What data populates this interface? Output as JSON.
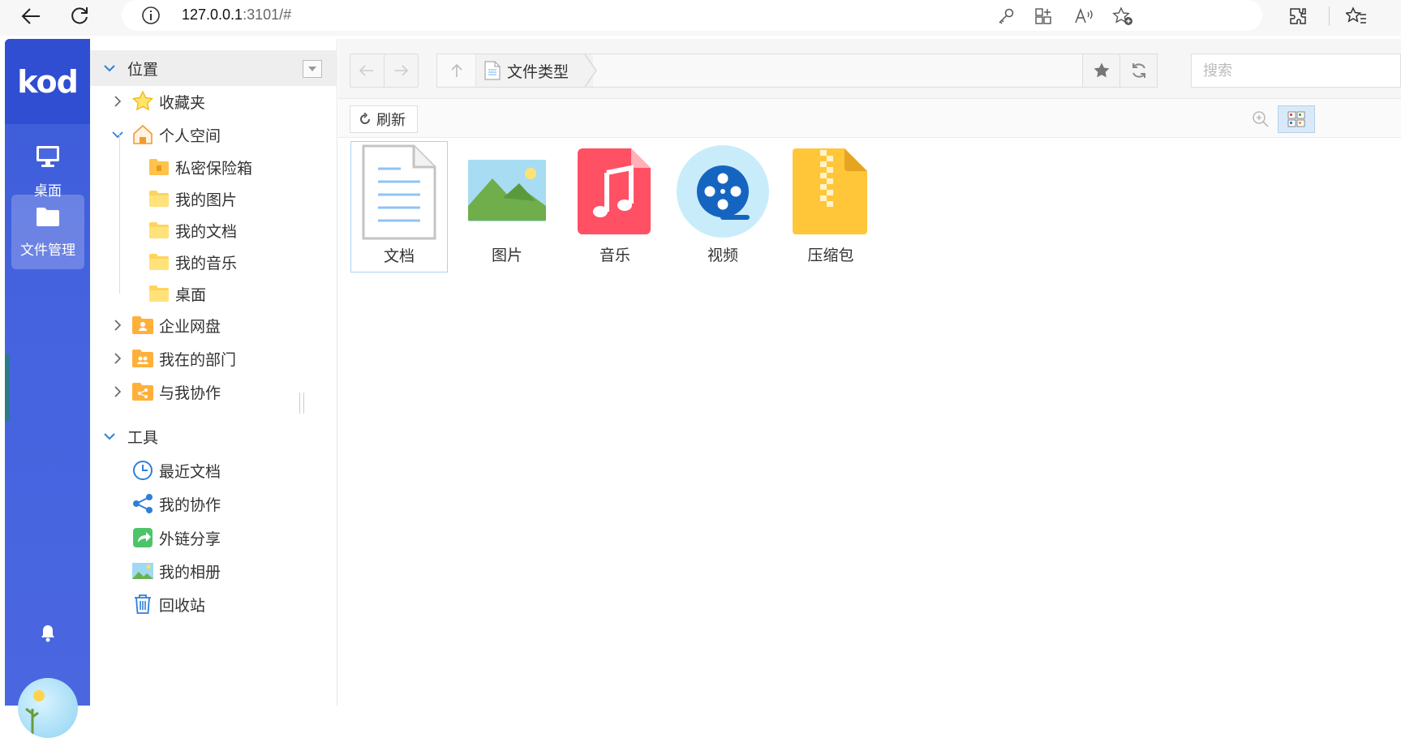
{
  "browser": {
    "url_host": "127.0.0.1",
    "url_rest": ":3101/#"
  },
  "rail": {
    "logo": "kod",
    "items": [
      {
        "label": "桌面",
        "icon": "monitor-icon"
      },
      {
        "label": "文件管理",
        "icon": "folder-icon"
      }
    ]
  },
  "tree": {
    "location_header": "位置",
    "items": [
      {
        "label": "收藏夹",
        "icon": "star-icon"
      },
      {
        "label": "个人空间",
        "icon": "home-icon"
      },
      {
        "label": "私密保险箱",
        "icon": "safe-folder-icon"
      },
      {
        "label": "我的图片",
        "icon": "folder-icon"
      },
      {
        "label": "我的文档",
        "icon": "folder-icon"
      },
      {
        "label": "我的音乐",
        "icon": "folder-icon"
      },
      {
        "label": "桌面",
        "icon": "folder-icon"
      },
      {
        "label": "企业网盘",
        "icon": "enterprise-folder-icon"
      },
      {
        "label": "我在的部门",
        "icon": "department-folder-icon"
      },
      {
        "label": "与我协作",
        "icon": "share-folder-icon"
      }
    ],
    "tools_header": "工具",
    "tools": [
      {
        "label": "最近文档",
        "icon": "clock-icon"
      },
      {
        "label": "我的协作",
        "icon": "share-nodes-icon"
      },
      {
        "label": "外链分享",
        "icon": "external-share-icon"
      },
      {
        "label": "我的相册",
        "icon": "album-icon"
      },
      {
        "label": "回收站",
        "icon": "trash-icon"
      }
    ]
  },
  "toolbar": {
    "breadcrumb": "文件类型",
    "search_placeholder": "搜索",
    "refresh_label": "刷新"
  },
  "files": [
    {
      "name": "文档",
      "icon": "document-icon"
    },
    {
      "name": "图片",
      "icon": "image-icon"
    },
    {
      "name": "音乐",
      "icon": "music-icon"
    },
    {
      "name": "视频",
      "icon": "video-icon"
    },
    {
      "name": "压缩包",
      "icon": "archive-icon"
    }
  ],
  "colors": {
    "rail": "#4563df",
    "accent": "#2f7fd8"
  }
}
